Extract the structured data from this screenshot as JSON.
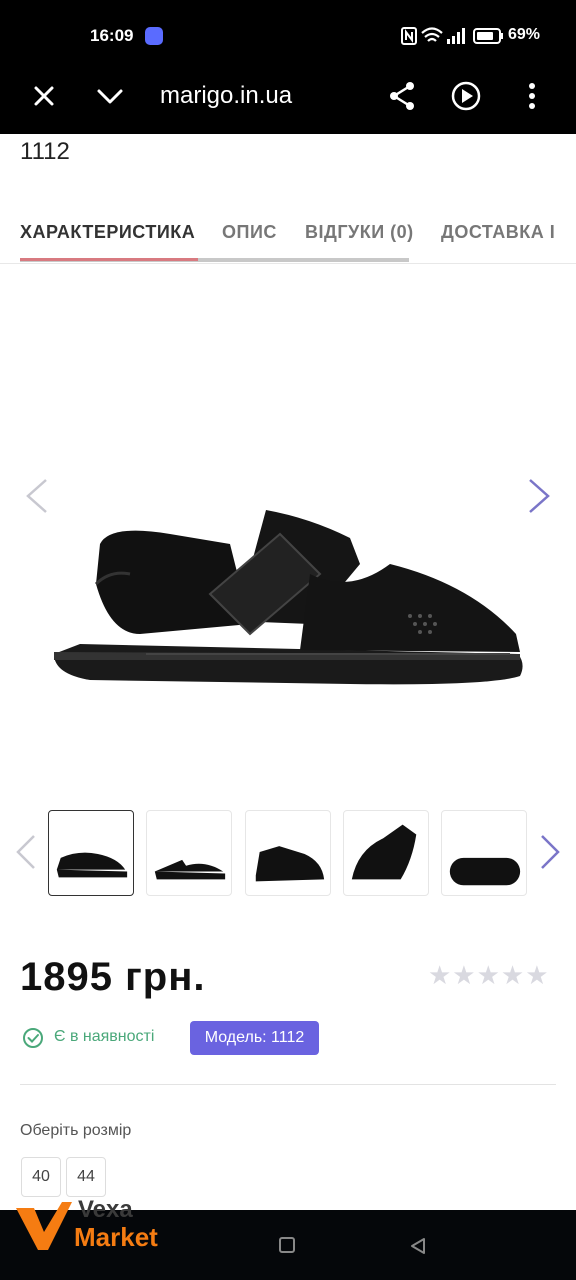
{
  "status": {
    "time": "16:09",
    "battery_pct": "69%",
    "icons": [
      "nfc-icon",
      "wifi-icon",
      "signal-icon",
      "battery-icon"
    ]
  },
  "browser": {
    "url": "marigo.in.ua"
  },
  "page": {
    "title_fragment": "1112"
  },
  "tabs": [
    {
      "label": "ХАРАКТЕРИСТИКА",
      "active": true
    },
    {
      "label": "ОПИС",
      "active": false
    },
    {
      "label": "ВІДГУКИ (0)",
      "active": false
    },
    {
      "label": "ДОСТАВКА І",
      "active": false
    }
  ],
  "product": {
    "price": "1895 грн.",
    "rating_stars": "★★★★★",
    "rating_value": 0,
    "stock": "Є в наявності",
    "model": "Модель: 1112",
    "size_label": "Оберіть розмір",
    "sizes": [
      "40",
      "44"
    ]
  },
  "thumbnails_count": 5,
  "watermark": {
    "line1": "Vexa",
    "line2": "Market"
  },
  "colors": {
    "accent": "#6a63e0",
    "stock": "#4aa87a",
    "tab_active_underline": "#d87a80",
    "logo_orange": "#f57c12"
  }
}
